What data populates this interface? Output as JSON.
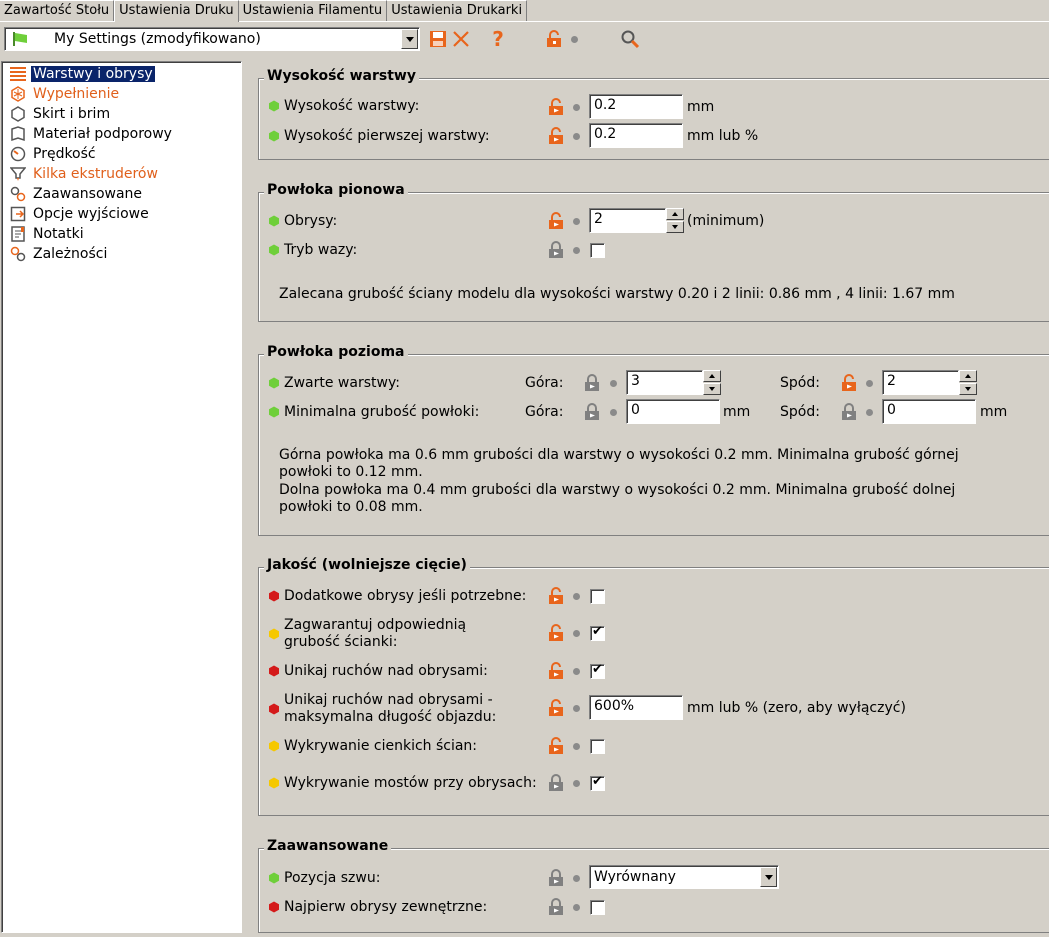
{
  "tabs": [
    "Zawartość Stołu",
    "Ustawienia Druku",
    "Ustawienia Filamentu",
    "Ustawienia Drukarki"
  ],
  "active_tab": 1,
  "preset": {
    "value": "My Settings (zmodyfikowano)"
  },
  "toolbar_icons": [
    "save-icon",
    "delete-icon",
    "help-icon",
    "unlock-icon",
    "search-icon"
  ],
  "sidebar": {
    "items": [
      {
        "label": "Warstwy i obrysy",
        "icon": "layers-icon",
        "selected": true,
        "color": "#000000"
      },
      {
        "label": "Wypełnienie",
        "icon": "infill-icon",
        "color": "#e0601c"
      },
      {
        "label": "Skirt i brim",
        "icon": "skirt-icon",
        "color": "#000000"
      },
      {
        "label": "Materiał podporowy",
        "icon": "support-icon",
        "color": "#000000"
      },
      {
        "label": "Prędkość",
        "icon": "speed-icon",
        "color": "#000000"
      },
      {
        "label": "Kilka ekstruderów",
        "icon": "extruders-icon",
        "color": "#e0601c"
      },
      {
        "label": "Zaawansowane",
        "icon": "advanced-icon",
        "color": "#000000"
      },
      {
        "label": "Opcje wyjściowe",
        "icon": "output-icon",
        "color": "#000000"
      },
      {
        "label": "Notatki",
        "icon": "notes-icon",
        "color": "#000000"
      },
      {
        "label": "Zależności",
        "icon": "dependencies-icon",
        "color": "#000000"
      }
    ]
  },
  "groups": {
    "layer_height": {
      "title": "Wysokość warstwy",
      "layer_height": {
        "label": "Wysokość warstwy:",
        "value": "0.2",
        "unit": "mm"
      },
      "first_layer_height": {
        "label": "Wysokość pierwszej warstwy:",
        "value": "0.2",
        "unit": "mm lub %"
      }
    },
    "vertical_shells": {
      "title": "Powłoka pionowa",
      "perimeters": {
        "label": "Obrysy:",
        "value": "2",
        "unit": "(minimum)"
      },
      "spiral_vase": {
        "label": "Tryb wazy:"
      },
      "note": "Zalecana grubość ściany modelu dla wysokości warstwy 0.20 i 2 linii: 0.86 mm , 4 linii: 1.67 mm"
    },
    "horizontal_shells": {
      "title": "Powłoka pozioma",
      "solid_layers": {
        "label": "Zwarte warstwy:",
        "top_label": "Góra:",
        "top_value": "3",
        "bottom_label": "Spód:",
        "bottom_value": "2"
      },
      "min_thickness": {
        "label": "Minimalna grubość powłoki:",
        "top_label": "Góra:",
        "top_value": "0",
        "top_unit": "mm",
        "bottom_label": "Spód:",
        "bottom_value": "0",
        "bottom_unit": "mm"
      },
      "note1": "Górna powłoka ma 0.6 mm grubości dla warstwy o wysokości 0.2 mm. Minimalna grubość górnej powłoki to 0.12 mm.",
      "note2": "Dolna powłoka ma 0.4 mm grubości dla warstwy o wysokości 0.2 mm. Minimalna grubość dolnej powłoki to 0.08 mm."
    },
    "quality": {
      "title": "Jakość (wolniejsze cięcie)",
      "extra_perimeters": {
        "label": "Dodatkowe obrysy jeśli potrzebne:",
        "checked": false
      },
      "ensure_thickness": {
        "label": "Zagwarantuj odpowiednią grubość ścianki:",
        "checked": true
      },
      "avoid_crossing": {
        "label": "Unikaj ruchów nad obrysami:",
        "checked": true
      },
      "avoid_crossing_max": {
        "label": "Unikaj ruchów nad obrysami - maksymalna długość objazdu:",
        "value": "600%",
        "unit": "mm lub % (zero, aby wyłączyć)"
      },
      "thin_walls": {
        "label": "Wykrywanie cienkich ścian:",
        "checked": false
      },
      "bridges": {
        "label": "Wykrywanie mostów przy obrysach:",
        "checked": true
      }
    },
    "advanced": {
      "title": "Zaawansowane",
      "seam": {
        "label": "Pozycja szwu:",
        "value": "Wyrównany"
      },
      "external_first": {
        "label": "Najpierw obrysy zewnętrzne:",
        "checked": false
      }
    }
  },
  "colors": {
    "simple": "#6fcf3a",
    "advanced": "#f5c800",
    "expert": "#d41a1a",
    "unlocked": "#e8651c",
    "locked": "#808080",
    "selection": "#0a246a"
  }
}
